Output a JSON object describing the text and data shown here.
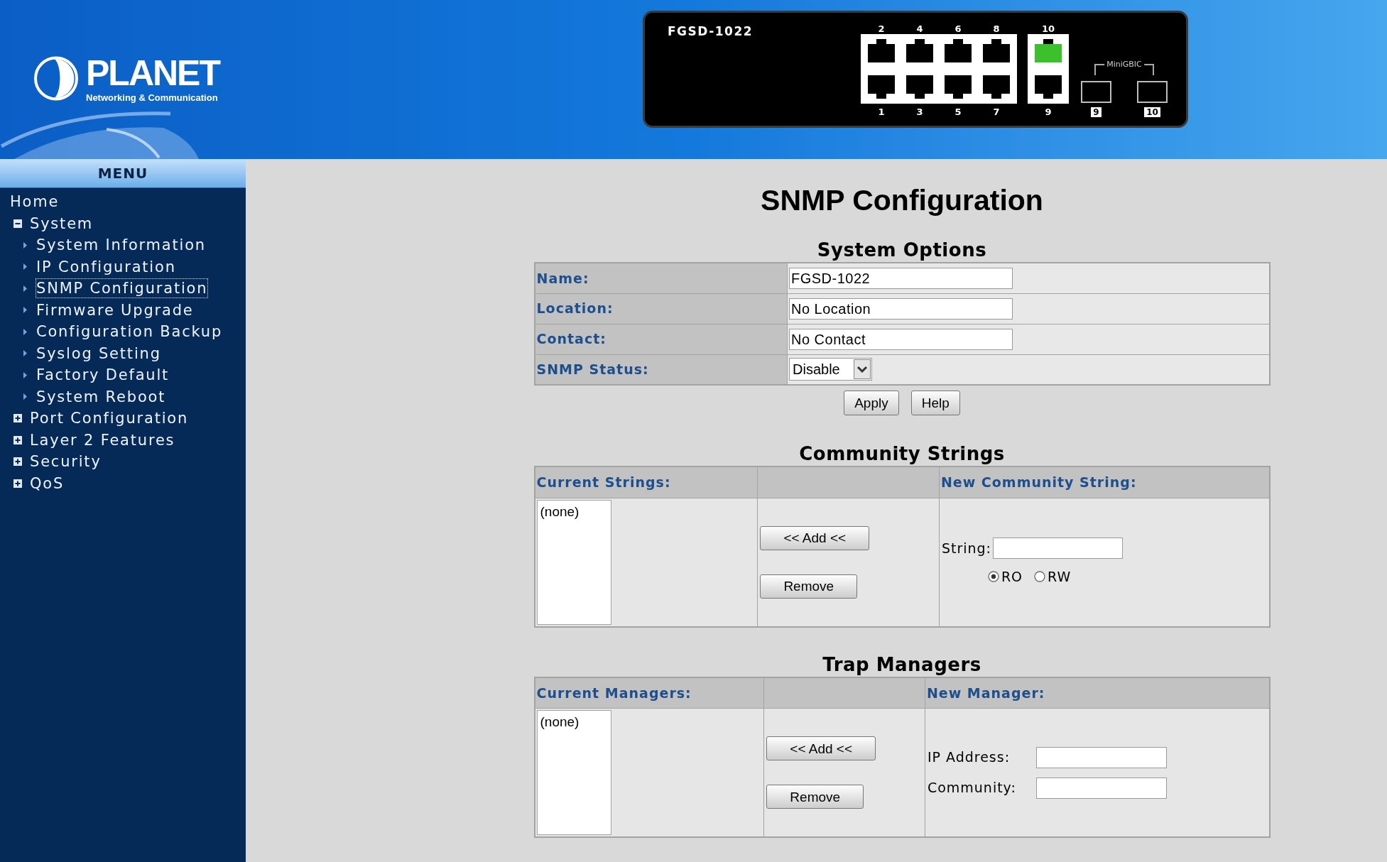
{
  "header": {
    "logo": {
      "name": "PLANET",
      "tagline": "Networking & Communication"
    },
    "device": {
      "model": "FGSD-1022",
      "port_blocks": [
        {
          "columns": [
            {
              "top": {
                "label": "2",
                "active": false
              },
              "bottom": {
                "label": "1",
                "active": false
              }
            },
            {
              "top": {
                "label": "4",
                "active": false
              },
              "bottom": {
                "label": "3",
                "active": false
              }
            },
            {
              "top": {
                "label": "6",
                "active": false
              },
              "bottom": {
                "label": "5",
                "active": false
              }
            },
            {
              "top": {
                "label": "8",
                "active": false
              },
              "bottom": {
                "label": "7",
                "active": false
              }
            }
          ]
        },
        {
          "columns": [
            {
              "top": {
                "label": "10",
                "active": true
              },
              "bottom": {
                "label": "9",
                "active": false
              }
            }
          ]
        }
      ],
      "minigbic": {
        "label": "MiniGBIC",
        "ports": [
          {
            "label": "9"
          },
          {
            "label": "10"
          }
        ]
      }
    }
  },
  "menu": {
    "title": "MENU",
    "items": [
      {
        "kind": "link",
        "label": "Home",
        "selected": false
      },
      {
        "kind": "group",
        "label": "System",
        "expanded": true,
        "selected": false,
        "children": [
          {
            "kind": "page",
            "label": "System Information",
            "selected": false
          },
          {
            "kind": "page",
            "label": "IP Configuration",
            "selected": false
          },
          {
            "kind": "page",
            "label": "SNMP Configuration",
            "selected": true
          },
          {
            "kind": "page",
            "label": "Firmware Upgrade",
            "selected": false
          },
          {
            "kind": "page",
            "label": "Configuration Backup",
            "selected": false
          },
          {
            "kind": "page",
            "label": "Syslog Setting",
            "selected": false
          },
          {
            "kind": "page",
            "label": "Factory Default",
            "selected": false
          },
          {
            "kind": "page",
            "label": "System Reboot",
            "selected": false
          }
        ]
      },
      {
        "kind": "group",
        "label": "Port Configuration",
        "expanded": false,
        "selected": false
      },
      {
        "kind": "group",
        "label": "Layer 2 Features",
        "expanded": false,
        "selected": false
      },
      {
        "kind": "group",
        "label": "Security",
        "expanded": false,
        "selected": false
      },
      {
        "kind": "group",
        "label": "QoS",
        "expanded": false,
        "selected": false
      }
    ]
  },
  "page": {
    "title": "SNMP Configuration",
    "system_options": {
      "heading": "System Options",
      "rows": [
        {
          "kind": "text",
          "label": "Name:",
          "value": "FGSD-1022"
        },
        {
          "kind": "text",
          "label": "Location:",
          "value": "No Location"
        },
        {
          "kind": "text",
          "label": "Contact:",
          "value": "No Contact"
        },
        {
          "kind": "select",
          "label": "SNMP Status:",
          "value": "Disable"
        }
      ],
      "buttons": [
        "Apply",
        "Help"
      ]
    },
    "community_strings": {
      "heading": "Community Strings",
      "current_header": "Current Strings:",
      "new_header": "New Community String:",
      "current_items": [
        "(none)"
      ],
      "buttons": [
        "<< Add <<",
        "Remove"
      ],
      "string_label": "String:",
      "access": [
        {
          "label": "RO",
          "selected": true
        },
        {
          "label": "RW",
          "selected": false
        }
      ]
    },
    "trap_managers": {
      "heading": "Trap Managers",
      "current_header": "Current Managers:",
      "new_header": "New Manager:",
      "current_items": [
        "(none)"
      ],
      "buttons": [
        "<< Add <<",
        "Remove"
      ],
      "fields": [
        {
          "label": "IP Address:"
        },
        {
          "label": "Community:"
        }
      ]
    }
  }
}
